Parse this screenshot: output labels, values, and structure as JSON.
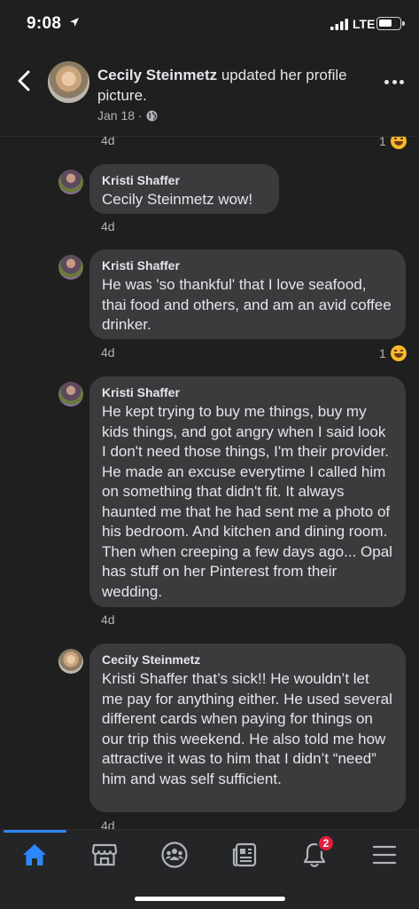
{
  "status_bar": {
    "time": "9:08",
    "network": "LTE"
  },
  "header": {
    "author_name": "Cecily Steinmetz",
    "action_text": " updated her profile picture.",
    "date": "Jan 18",
    "separator": "·"
  },
  "partial_top": {
    "timestamp": "4d",
    "reaction_count": "1"
  },
  "comments": [
    {
      "author": "Kristi Shaffer",
      "text": "Cecily Steinmetz wow!",
      "timestamp": "4d"
    },
    {
      "author": "Kristi Shaffer",
      "text": "He was 'so thankful' that I love seafood, thai food and others, and am an avid coffee drinker.",
      "timestamp": "4d",
      "reaction_count": "1"
    },
    {
      "author": "Kristi Shaffer",
      "text": "He kept trying to buy me things, buy my kids things, and got angry when I said look I don't need those things, I'm their provider. He made an excuse everytime I called him on something that didn't fit. It always haunted me that he had sent me a photo of his bedroom. And kitchen and dining room. Then when creeping a few days ago... Opal has stuff on her Pinterest from their wedding.",
      "timestamp": "4d"
    },
    {
      "author": "Cecily Steinmetz",
      "text": "Kristi Shaffer that’s sick!! He wouldn’t let me pay for anything either. He used several different cards when paying for things on our trip this weekend. He also told me how attractive it was to him that I didn’t “need” him and was self sufficient.",
      "timestamp": "4d"
    }
  ],
  "tab_bar": {
    "tabs": [
      "home",
      "marketplace",
      "groups",
      "news",
      "notifications",
      "menu"
    ],
    "notification_badge": "2",
    "active_color": "#2d88ff"
  }
}
